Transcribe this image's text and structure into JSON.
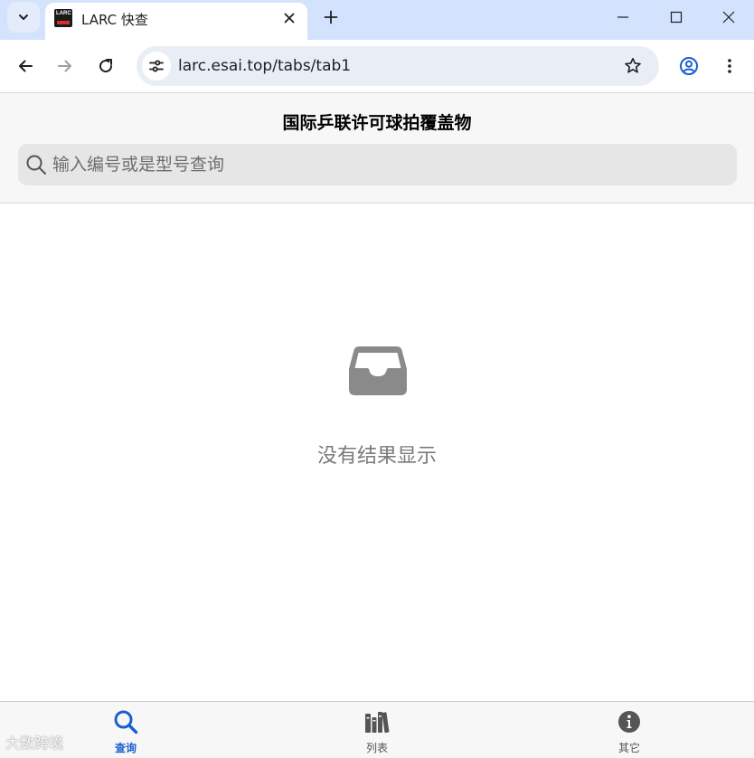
{
  "browser": {
    "tab": {
      "title": "LARC 快查",
      "favicon_text": "LARC"
    },
    "address_bar": {
      "url": "larc.esai.top/tabs/tab1"
    }
  },
  "header": {
    "title": "国际乒联许可球拍覆盖物"
  },
  "search": {
    "placeholder": "输入编号或是型号查询",
    "value": ""
  },
  "main": {
    "empty_message": "没有结果显示"
  },
  "tabbar": {
    "items": [
      {
        "label": "查询",
        "icon": "search-icon",
        "active": true
      },
      {
        "label": "列表",
        "icon": "books-icon",
        "active": false
      },
      {
        "label": "其它",
        "icon": "info-icon",
        "active": false
      }
    ]
  },
  "watermark": {
    "text": "大数跨境"
  },
  "colors": {
    "accent": "#1a5fd1",
    "tabstrip": "#d3e3fd",
    "empty_icon": "#8a8a8a",
    "tab_inactive": "#555555"
  }
}
